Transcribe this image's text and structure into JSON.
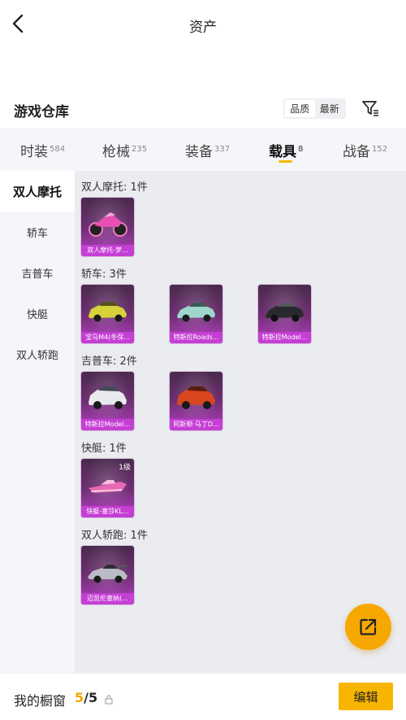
{
  "header": {
    "title": "资产"
  },
  "warehouse": {
    "title": "游戏仓库",
    "sort_quality": "品质",
    "sort_newest": "最新"
  },
  "tabs": [
    {
      "label": "时装",
      "count": "584"
    },
    {
      "label": "枪械",
      "count": "235"
    },
    {
      "label": "装备",
      "count": "337"
    },
    {
      "label": "载具",
      "count": "8",
      "active": true
    },
    {
      "label": "战备",
      "count": "152"
    }
  ],
  "sidebar": {
    "items": [
      {
        "label": "双人摩托",
        "active": true
      },
      {
        "label": "轿车"
      },
      {
        "label": "吉普车"
      },
      {
        "label": "快艇"
      },
      {
        "label": "双人轿跑"
      }
    ]
  },
  "sections": [
    {
      "label": "双人摩托: 1件",
      "items": [
        {
          "name": "双人摩托-梦...",
          "vehicle": "motorcycle",
          "color": "#e84fb0"
        }
      ]
    },
    {
      "label": "轿车: 3件",
      "items": [
        {
          "name": "宝马M4(冬保...",
          "vehicle": "car",
          "color": "#d8d23a"
        },
        {
          "name": "特斯拉Roads...",
          "vehicle": "car",
          "color": "#9ed6cc"
        },
        {
          "name": "特斯拉Model...",
          "vehicle": "car",
          "color": "#2a2a2e"
        }
      ]
    },
    {
      "label": "吉普车: 2件",
      "items": [
        {
          "name": "特斯拉Model...",
          "vehicle": "suv",
          "color": "#e9e9ee"
        },
        {
          "name": "阿斯顿·马丁D...",
          "vehicle": "suv",
          "color": "#d9461e"
        }
      ]
    },
    {
      "label": "快艇: 1件",
      "items": [
        {
          "name": "快艇-塞莎KL...",
          "vehicle": "boat",
          "color": "#e86ab2",
          "level": "1级"
        }
      ]
    },
    {
      "label": "双人轿跑: 1件",
      "items": [
        {
          "name": "迈凯伦塞纳(...",
          "vehicle": "sport",
          "color": "#b9bcc4"
        }
      ]
    }
  ],
  "showcase": {
    "label": "我的橱窗",
    "current": "5",
    "total": "/5"
  },
  "edit_label": "编辑",
  "colors": {
    "accent": "#f7b500",
    "card": "#b63ec4"
  }
}
